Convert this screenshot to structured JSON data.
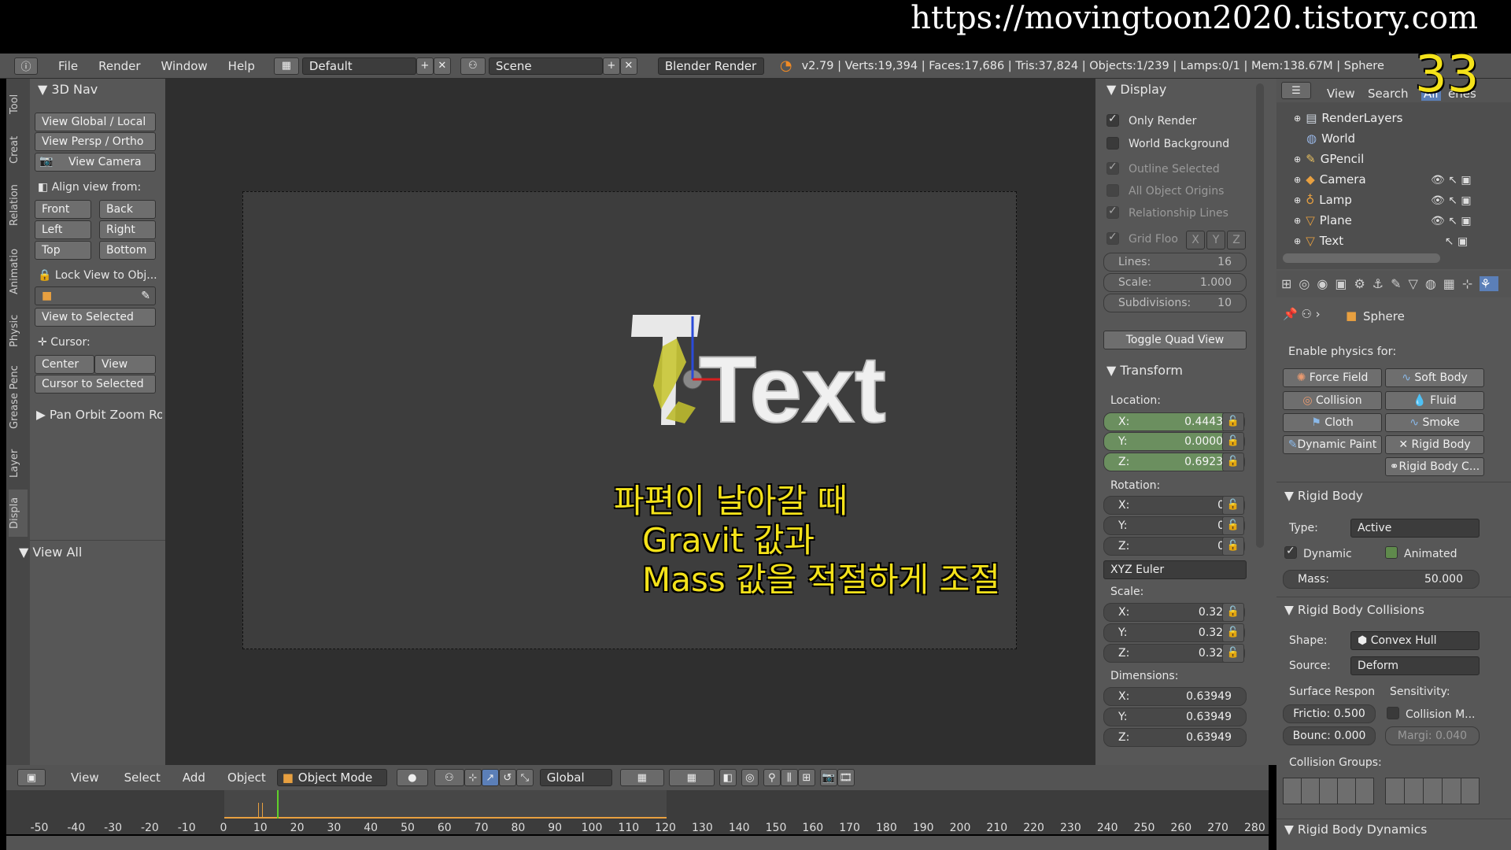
{
  "watermark": "https://movingtoon2020.tistory.com",
  "episode_badge": "33",
  "menubar": {
    "items": [
      "File",
      "Render",
      "Window",
      "Help"
    ],
    "layout": "Default",
    "scene": "Scene",
    "engine": "Blender Render",
    "stats": "v2.79 | Verts:19,394 | Faces:17,686 | Tris:37,824 | Objects:1/239 | Lamps:0/1 | Mem:138.67M | Sphere"
  },
  "tool_tabs": [
    "Tool",
    "Creat",
    "Relation",
    "Animatio",
    "Physic",
    "Grease Penc",
    "Layer",
    "Displa"
  ],
  "nav_panel": {
    "title": "3D Nav",
    "view_global": "View Global / Local",
    "view_persp": "View Persp / Ortho",
    "view_camera": "View Camera",
    "align_label": "Align view from:",
    "front": "Front",
    "back": "Back",
    "left": "Left",
    "right": "Right",
    "top": "Top",
    "bottom": "Bottom",
    "lock_view": "Lock View to Obj...",
    "view_selected": "View to Selected",
    "cursor_label": "Cursor:",
    "center": "Center",
    "view": "View",
    "cursor_selected": "Cursor to Selected",
    "pan_orbit": "Pan Orbit Zoom Roll",
    "view_all": "View All"
  },
  "viewport": {
    "text_object": "Text",
    "subtitle_lines": [
      "파편이 날아갈 때",
      "Gravit 값과",
      "Mass  값을 적절하게 조절"
    ]
  },
  "display_panel": {
    "title": "Display",
    "only_render": "Only Render",
    "world_background": "World Background",
    "outline_selected": "Outline Selected",
    "all_object_origins": "All Object Origins",
    "relationship_lines": "Relationship Lines",
    "grid_floor": "Grid Floo",
    "axes": [
      "X",
      "Y",
      "Z"
    ],
    "lines_label": "Lines:",
    "lines_value": "16",
    "scale_label": "Scale:",
    "scale_value": "1.000",
    "subdiv_label": "Subdivisions:",
    "subdiv_value": "10",
    "toggle_quad": "Toggle Quad View"
  },
  "transform_panel": {
    "title": "Transform",
    "location_label": "Location:",
    "loc": [
      {
        "axis": "X:",
        "value": "0.44430"
      },
      {
        "axis": "Y:",
        "value": "0.00007"
      },
      {
        "axis": "Z:",
        "value": "0.69238"
      }
    ],
    "rotation_label": "Rotation:",
    "rot": [
      {
        "axis": "X:",
        "value": "0°"
      },
      {
        "axis": "Y:",
        "value": "0°"
      },
      {
        "axis": "Z:",
        "value": "0°"
      }
    ],
    "rotation_mode": "XYZ Euler",
    "scale_label": "Scale:",
    "scale": [
      {
        "axis": "X:",
        "value": "0.320"
      },
      {
        "axis": "Y:",
        "value": "0.320"
      },
      {
        "axis": "Z:",
        "value": "0.320"
      }
    ],
    "dimensions_label": "Dimensions:",
    "dim": [
      {
        "axis": "X:",
        "value": "0.63949"
      },
      {
        "axis": "Y:",
        "value": "0.63949"
      },
      {
        "axis": "Z:",
        "value": "0.63949"
      }
    ]
  },
  "outliner": {
    "view": "View",
    "search": "Search",
    "filter": "All",
    "scenes": "enes",
    "items": [
      "RenderLayers",
      "World",
      "GPencil",
      "Camera",
      "Lamp",
      "Plane",
      "Text"
    ]
  },
  "physics": {
    "object_name": "Sphere",
    "enable_label": "Enable physics for:",
    "buttons_left": [
      "Force Field",
      "Collision",
      "Cloth",
      "Dynamic Paint"
    ],
    "buttons_right": [
      "Soft Body",
      "Fluid",
      "Smoke",
      "Rigid Body",
      "Rigid Body C..."
    ],
    "rigid_body": {
      "title": "Rigid Body",
      "type_label": "Type:",
      "type_value": "Active",
      "dynamic": "Dynamic",
      "animated": "Animated",
      "mass_label": "Mass:",
      "mass_value": "50.000"
    },
    "collisions": {
      "title": "Rigid Body Collisions",
      "shape_label": "Shape:",
      "shape_value": "Convex Hull",
      "source_label": "Source:",
      "source_value": "Deform",
      "surface_label": "Surface Respon",
      "sensitivity_label": "Sensitivity:",
      "friction": "Frictio: 0.500",
      "bounce": "Bounc: 0.000",
      "collision_margin": "Collision M...",
      "margin": "Margi: 0.040",
      "groups_label": "Collision Groups:"
    },
    "dynamics_title": "Rigid Body Dynamics"
  },
  "bottom_header": {
    "items": [
      "View",
      "Select",
      "Add",
      "Object"
    ],
    "mode": "Object Mode",
    "orientation": "Global"
  },
  "timeline_ticks": [
    "-50",
    "-40",
    "-30",
    "-20",
    "-10",
    "0",
    "10",
    "20",
    "30",
    "40",
    "50",
    "60",
    "70",
    "80",
    "90",
    "100",
    "110",
    "120",
    "130",
    "140",
    "150",
    "160",
    "170",
    "180",
    "190",
    "200",
    "210",
    "220",
    "230",
    "240",
    "250",
    "260",
    "270",
    "280"
  ]
}
